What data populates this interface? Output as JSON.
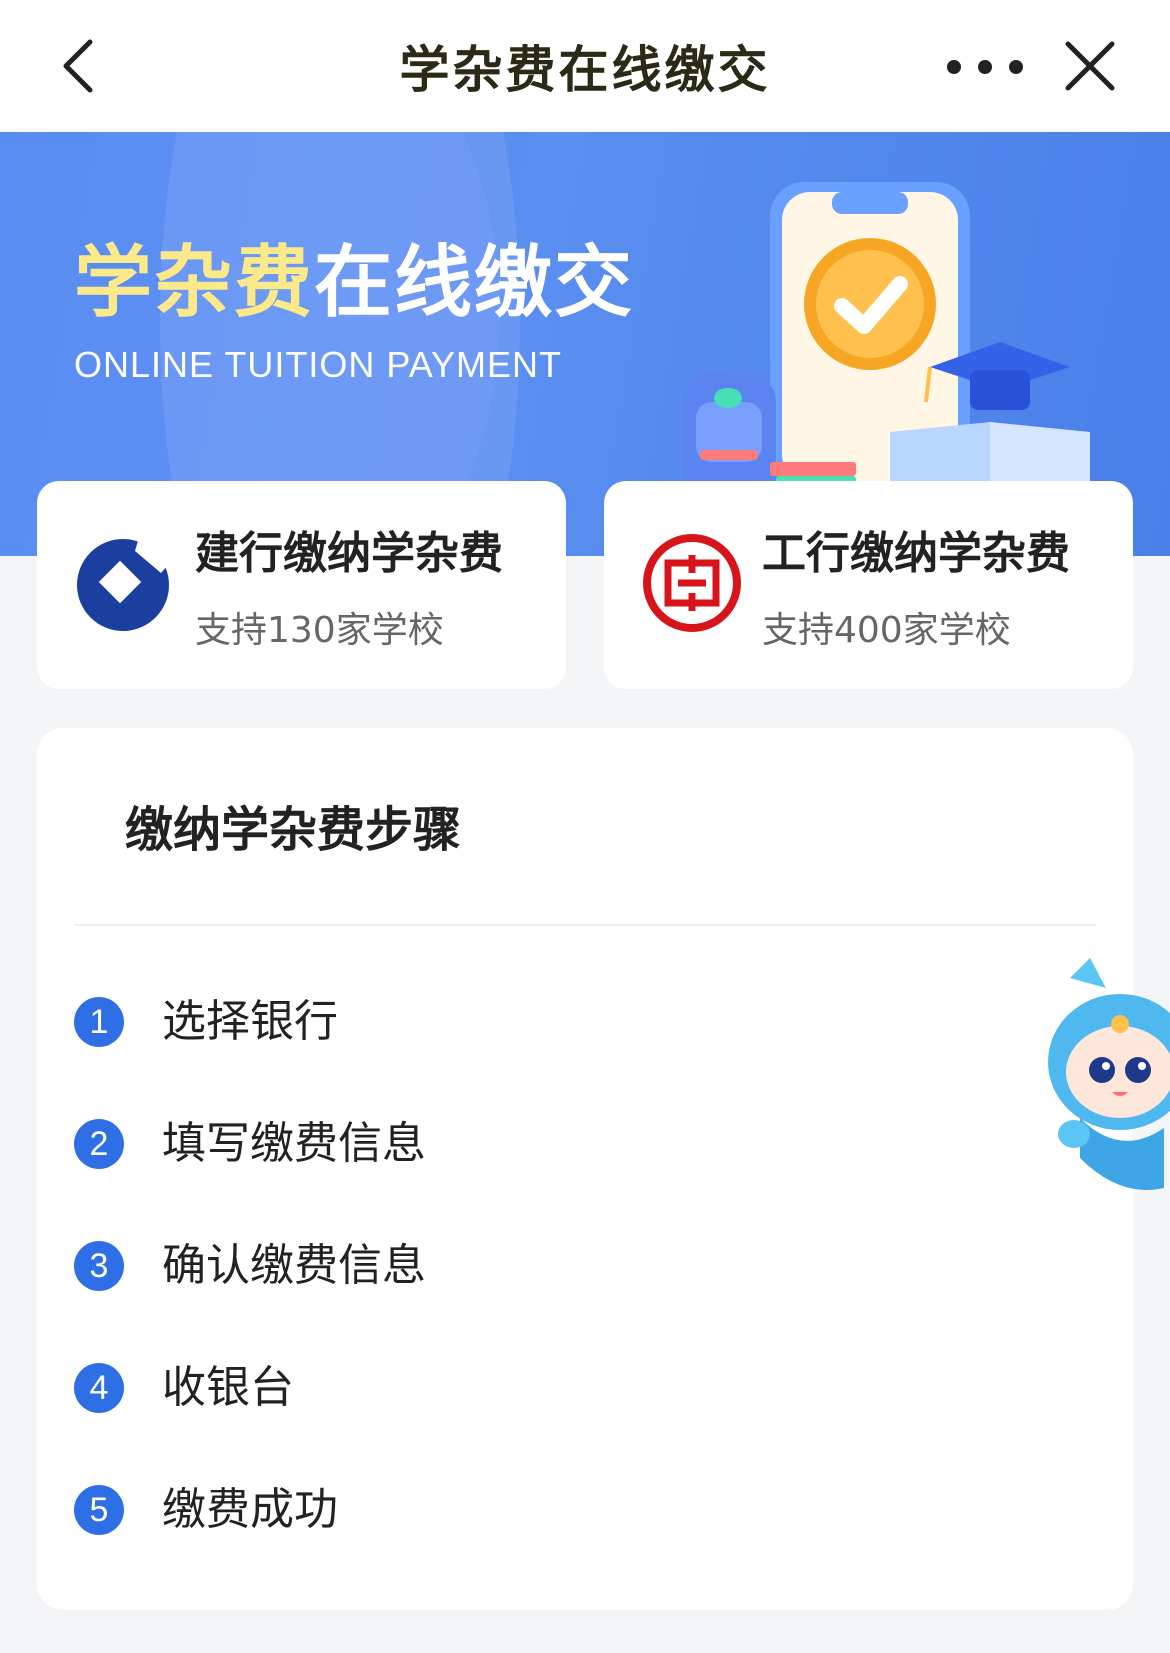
{
  "nav": {
    "title": "学杂费在线缴交"
  },
  "banner": {
    "title_highlight": "学杂费",
    "title_rest": "在线缴交",
    "subtitle": "ONLINE TUITION PAYMENT"
  },
  "banks": [
    {
      "name": "建行缴纳学杂费",
      "support": "支持130家学校",
      "logo": "ccb-logo-icon",
      "color": "#1a3f9e"
    },
    {
      "name": "工行缴纳学杂费",
      "support": "支持400家学校",
      "logo": "icbc-logo-icon",
      "color": "#d7141a"
    }
  ],
  "steps": {
    "title": "缴纳学杂费步骤",
    "items": [
      {
        "num": "1",
        "label": "选择银行"
      },
      {
        "num": "2",
        "label": "填写缴费信息"
      },
      {
        "num": "3",
        "label": "确认缴费信息"
      },
      {
        "num": "4",
        "label": "收银台"
      },
      {
        "num": "5",
        "label": "缴费成功"
      }
    ]
  },
  "colors": {
    "banner": "#4f86ee",
    "highlight": "#fbe98a",
    "step_badge": "#2f6fe6"
  }
}
